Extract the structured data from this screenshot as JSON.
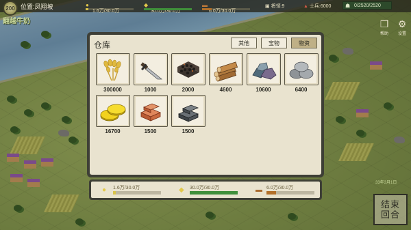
{
  "topbar": {
    "level_badge": "200",
    "location": "位置:凤翔坡",
    "resources": [
      {
        "icon": "grain-icon",
        "text": "1.6万/30.0万",
        "fraction": 0.053,
        "color": "#d8c34a"
      },
      {
        "icon": "coin-icon",
        "text": "30.0万/30.0万",
        "fraction": 1.0,
        "color": "#3f8f3a"
      },
      {
        "icon": "wood-icon",
        "text": "6.0万/30.0万",
        "fraction": 0.2,
        "color": "#b2702a"
      }
    ],
    "generals": "将领:9",
    "soldiers": "士兵:6000",
    "population": "0/2520/2520"
  },
  "map": {
    "label": "翻越牛奶",
    "date": "33年3月1日"
  },
  "side_buttons": {
    "help": "帮助",
    "settings": "设置"
  },
  "end_turn": {
    "line1": "结束",
    "line2": "回合"
  },
  "warehouse": {
    "title": "仓库",
    "tabs": [
      {
        "label": "其他",
        "active": false
      },
      {
        "label": "宝物",
        "active": false
      },
      {
        "label": "物资",
        "active": true
      }
    ],
    "items": [
      {
        "name": "wheat",
        "icon": "wheat-icon",
        "qty": "300000"
      },
      {
        "name": "dagger",
        "icon": "dagger-icon",
        "qty": "1000"
      },
      {
        "name": "coal",
        "icon": "coal-icon",
        "qty": "2000"
      },
      {
        "name": "timber",
        "icon": "timber-icon",
        "qty": "4600"
      },
      {
        "name": "ore",
        "icon": "ore-icon",
        "qty": "10600"
      },
      {
        "name": "stone",
        "icon": "stone-icon",
        "qty": "6400"
      },
      {
        "name": "gold",
        "icon": "gold-icon",
        "qty": "16700"
      },
      {
        "name": "brick",
        "icon": "brick-icon",
        "qty": "1500"
      },
      {
        "name": "iron",
        "icon": "iron-icon",
        "qty": "1500"
      }
    ]
  },
  "summary": {
    "items": [
      {
        "icon": "grain-icon",
        "text": "1.6万/30.0万",
        "fraction": 0.053,
        "color": "#d8c34a"
      },
      {
        "icon": "coin-icon",
        "text": "30.0万/30.0万",
        "fraction": 1.0,
        "color": "#3f8f3a"
      },
      {
        "icon": "wood-icon",
        "text": "6.0万/30.0万",
        "fraction": 0.2,
        "color": "#b2702a"
      }
    ]
  }
}
